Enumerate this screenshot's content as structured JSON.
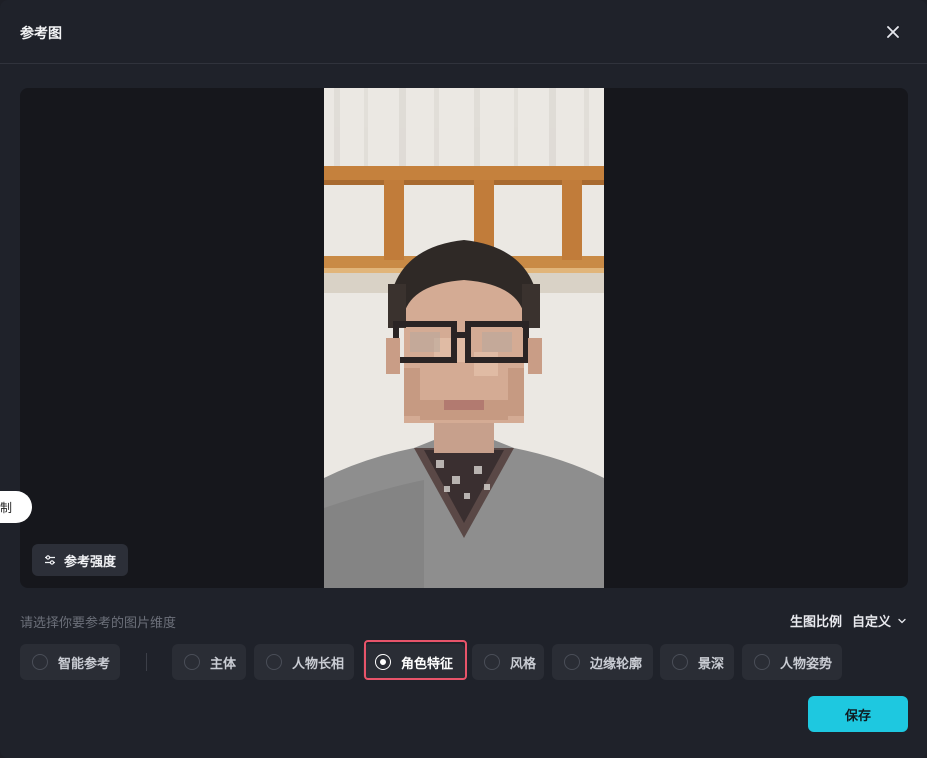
{
  "dialog": {
    "title": "参考图",
    "close_icon": "close-icon"
  },
  "preview": {
    "strength_label": "参考强度",
    "side_pill_label": "制"
  },
  "dimension": {
    "prompt": "请选择你要参考的图片维度",
    "ratio_label": "生图比例",
    "ratio_value": "自定义",
    "options": [
      {
        "label": "智能参考",
        "selected": false
      },
      {
        "label": "主体",
        "selected": false
      },
      {
        "label": "人物长相",
        "selected": false
      },
      {
        "label": "角色特征",
        "selected": true
      },
      {
        "label": "风格",
        "selected": false
      },
      {
        "label": "边缘轮廓",
        "selected": false
      },
      {
        "label": "景深",
        "selected": false
      },
      {
        "label": "人物姿势",
        "selected": false
      }
    ]
  },
  "footer": {
    "save_label": "保存"
  },
  "colors": {
    "accent": "#1ec8e0",
    "highlight": "#e8546a",
    "background": "#1f222a"
  }
}
